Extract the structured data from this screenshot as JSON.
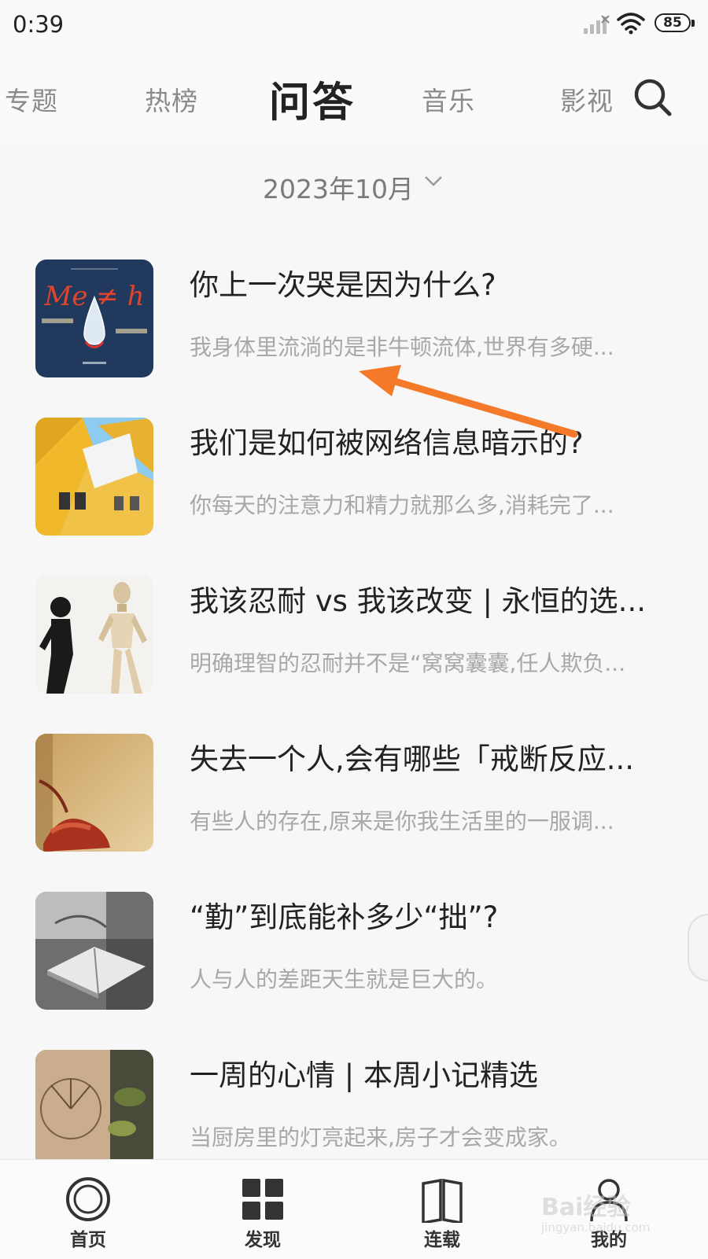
{
  "status_bar": {
    "time": "0:39",
    "battery": "85",
    "icons": [
      "signal-icon",
      "wifi-icon",
      "battery-icon"
    ]
  },
  "top_nav": {
    "tabs": [
      {
        "label": "专题",
        "active": false
      },
      {
        "label": "热榜",
        "active": false
      },
      {
        "label": "问答",
        "active": true
      },
      {
        "label": "音乐",
        "active": false
      },
      {
        "label": "影视",
        "active": false
      }
    ],
    "search_icon": "search-icon"
  },
  "month_selector": {
    "label": "2023年10月",
    "icon": "chevron-down-icon"
  },
  "questions": [
    {
      "title": "你上一次哭是因为什么?",
      "summary": "我身体里流淌的是非牛顿流体,世界有多硬...",
      "thumb": "teardrop-poster",
      "thumb_text": "Me ≠ h"
    },
    {
      "title": "我们是如何被网络信息暗示的?",
      "summary": "你每天的注意力和精力就那么多,消耗完了...",
      "thumb": "yellow-cube-houses"
    },
    {
      "title": "我该忍耐 vs 我该改变 | 永恒的选...",
      "summary": "明确理智的忍耐并不是“窝窝囊囊,任人欺负...",
      "thumb": "wooden-mannequin-shadow"
    },
    {
      "title": "失去一个人,会有哪些「戒断反应...",
      "summary": "有些人的存在,原来是你我生活里的一服调...",
      "thumb": "red-telephone"
    },
    {
      "title": "“勤”到底能补多少“拙”?",
      "summary": "人与人的差距天生就是巨大的。",
      "thumb": "open-book-grayscale"
    },
    {
      "title": "一周的心情 | 本周小记精选",
      "summary": "当厨房里的灯亮起来,房子才会变成家。",
      "thumb": "sundial-wall"
    }
  ],
  "bottom_nav": [
    {
      "label": "首页",
      "icon": "home-circle-icon"
    },
    {
      "label": "发现",
      "icon": "grid-icon"
    },
    {
      "label": "连载",
      "icon": "book-icon"
    },
    {
      "label": "我的",
      "icon": "user-icon"
    }
  ],
  "watermark": {
    "text": "Bai经验",
    "sub": "jingyan.baidu.com"
  },
  "colors": {
    "background": "#f7f7f7",
    "title_text": "#222222",
    "muted_text": "#a8a8a8",
    "annotation_arrow": "#f47a2a"
  }
}
